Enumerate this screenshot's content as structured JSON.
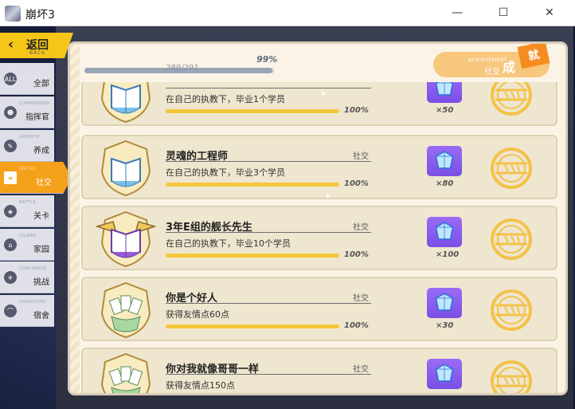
{
  "window": {
    "title": "崩坏3",
    "minimize_glyph": "—",
    "maximize_glyph": "☐",
    "close_glyph": "✕"
  },
  "back": {
    "label": "返回",
    "sub": "BACK",
    "chevron": "‹"
  },
  "sidebar": {
    "items": [
      {
        "sub": "",
        "label": "全部",
        "icon": "all-icon",
        "glyph": "ALL",
        "active": false
      },
      {
        "sub": "COMMANDER",
        "label": "指挥官",
        "icon": "commander-icon",
        "glyph": "☻",
        "active": false
      },
      {
        "sub": "GROWTH",
        "label": "养成",
        "icon": "growth-icon",
        "glyph": "✎",
        "active": false
      },
      {
        "sub": "SOCIAL",
        "label": "社交",
        "icon": "social-icon",
        "glyph": "≡",
        "active": true
      },
      {
        "sub": "BATTLE",
        "label": "关卡",
        "icon": "battle-icon",
        "glyph": "◈",
        "active": false
      },
      {
        "sub": "ISLAND",
        "label": "家园",
        "icon": "home-icon",
        "glyph": "⌂",
        "active": false
      },
      {
        "sub": "CHALLENGE",
        "label": "挑战",
        "icon": "challenge-icon",
        "glyph": "✈",
        "active": false
      },
      {
        "sub": "DORMITORY",
        "label": "宿舍",
        "icon": "dorm-icon",
        "glyph": "⌒",
        "active": false
      }
    ]
  },
  "progress": {
    "percent_text": "99%",
    "count_text": "289/291",
    "fraction": 0.99
  },
  "achievement_badge": {
    "en": "ACHIEVEMENT",
    "category": "社交",
    "char1": "成",
    "char2": "就"
  },
  "cards": [
    {
      "name": "",
      "category": "",
      "desc": "在自己的执教下，毕业1个学员",
      "percent": "100%",
      "progress": 1.0,
      "reward_qty": "×50",
      "emblem": "book-emblem"
    },
    {
      "name": "灵魂的工程师",
      "category": "社交",
      "desc": "在自己的执教下，毕业3个学员",
      "percent": "100%",
      "progress": 1.0,
      "reward_qty": "×80",
      "emblem": "book-emblem"
    },
    {
      "name": "3年E组的舰长先生",
      "category": "社交",
      "desc": "在自己的执教下，毕业10个学员",
      "percent": "100%",
      "progress": 1.0,
      "reward_qty": "×100",
      "emblem": "book-wings-emblem"
    },
    {
      "name": "你是个好人",
      "category": "社交",
      "desc": "获得友情点60点",
      "percent": "100%",
      "progress": 1.0,
      "reward_qty": "×30",
      "emblem": "cards-emblem"
    },
    {
      "name": "你对我就像哥哥一样",
      "category": "社交",
      "desc": "获得友情点150点",
      "percent": "",
      "progress": 1.0,
      "reward_qty": "",
      "emblem": "cards-emblem"
    }
  ],
  "colors": {
    "accent": "#f5a01a",
    "back_yellow": "#f5c518",
    "reward_purple": "#8a5cf0",
    "progress_yellow": "#f3c73b"
  }
}
